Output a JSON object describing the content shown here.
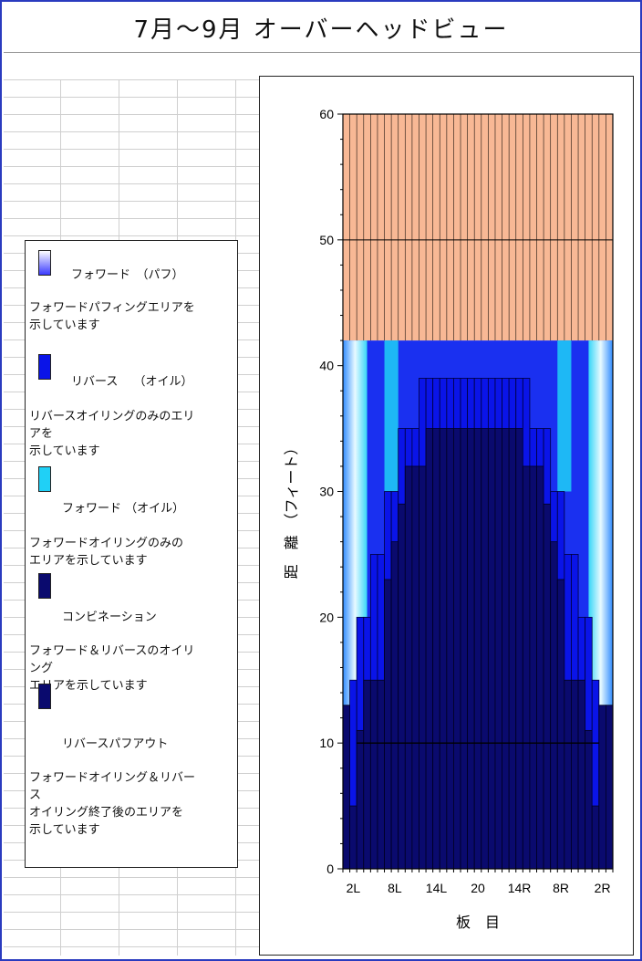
{
  "title": "7月〜9月 オーバーヘッドビュー",
  "legend": {
    "items": [
      {
        "name": "フォワード　（パフ）",
        "desc": "フォワードパフィングエリアを\n示しています",
        "icon": "gradient-swatch"
      },
      {
        "name": "リバース　 （オイル）",
        "desc": "リバースオイリングのみのエリ\nアを\n示しています",
        "color": "#0a14e8"
      },
      {
        "name": "フォワード （オイル）",
        "desc": "フォワードオイリングのみの\nエリアを示しています",
        "color": "#20d0f6"
      },
      {
        "name": "コンビネーション",
        "desc": "フォワード＆リバースのオイリ\nング\nエリアを示しています",
        "color": "#0a0a6e"
      },
      {
        "name": "リバースパフアウト",
        "desc": "フォワードオイリング＆リバー\nス\nオイリング終了後のエリアを\n示しています",
        "color": "#0a0a6e"
      }
    ]
  },
  "chart_data": {
    "type": "bar",
    "xlabel": "板　目",
    "ylabel": "距　離　（フィート）",
    "ylim": [
      0,
      60
    ],
    "yticks": [
      0,
      10,
      20,
      30,
      40,
      50,
      60
    ],
    "xtick_labels": [
      "2L",
      "8L",
      "14L",
      "20",
      "14R",
      "8R",
      "2R"
    ],
    "boards": [
      "1L",
      "2L",
      "3L",
      "4L",
      "5L",
      "6L",
      "7L",
      "8L",
      "9L",
      "10L",
      "11L",
      "12L",
      "13L",
      "14L",
      "15L",
      "16L",
      "17L",
      "18L",
      "19L",
      "20",
      "19R",
      "18R",
      "17R",
      "16R",
      "15R",
      "14R",
      "13R",
      "12R",
      "11R",
      "10R",
      "9R",
      "8R",
      "7R",
      "6R",
      "5R",
      "4R",
      "3R",
      "2R",
      "1R"
    ],
    "puff_out_from": 42,
    "puff_out_to": 60,
    "combination": [
      13,
      5,
      11,
      15,
      15,
      15,
      23,
      26,
      29,
      32,
      32,
      32,
      35,
      35,
      35,
      35,
      35,
      35,
      35,
      35,
      35,
      35,
      35,
      35,
      35,
      35,
      32,
      32,
      32,
      29,
      26,
      23,
      15,
      15,
      15,
      11,
      5,
      13,
      13
    ],
    "reverse_oil": [
      13,
      15,
      20,
      20,
      25,
      25,
      30,
      30,
      35,
      35,
      35,
      39,
      39,
      39,
      39,
      39,
      39,
      39,
      39,
      39,
      39,
      39,
      39,
      39,
      39,
      39,
      39,
      35,
      35,
      35,
      30,
      30,
      25,
      25,
      20,
      20,
      15,
      13,
      13
    ],
    "markers": [
      10,
      50
    ],
    "colors": {
      "puff_out": "#f8b895",
      "combination": "#0a0a6e",
      "reverse_oil": "#0a14e8",
      "forward_oil": "#20d0f6",
      "forward_puff_top": "#ffffff",
      "forward_puff_bottom": "#3a3aff"
    }
  }
}
